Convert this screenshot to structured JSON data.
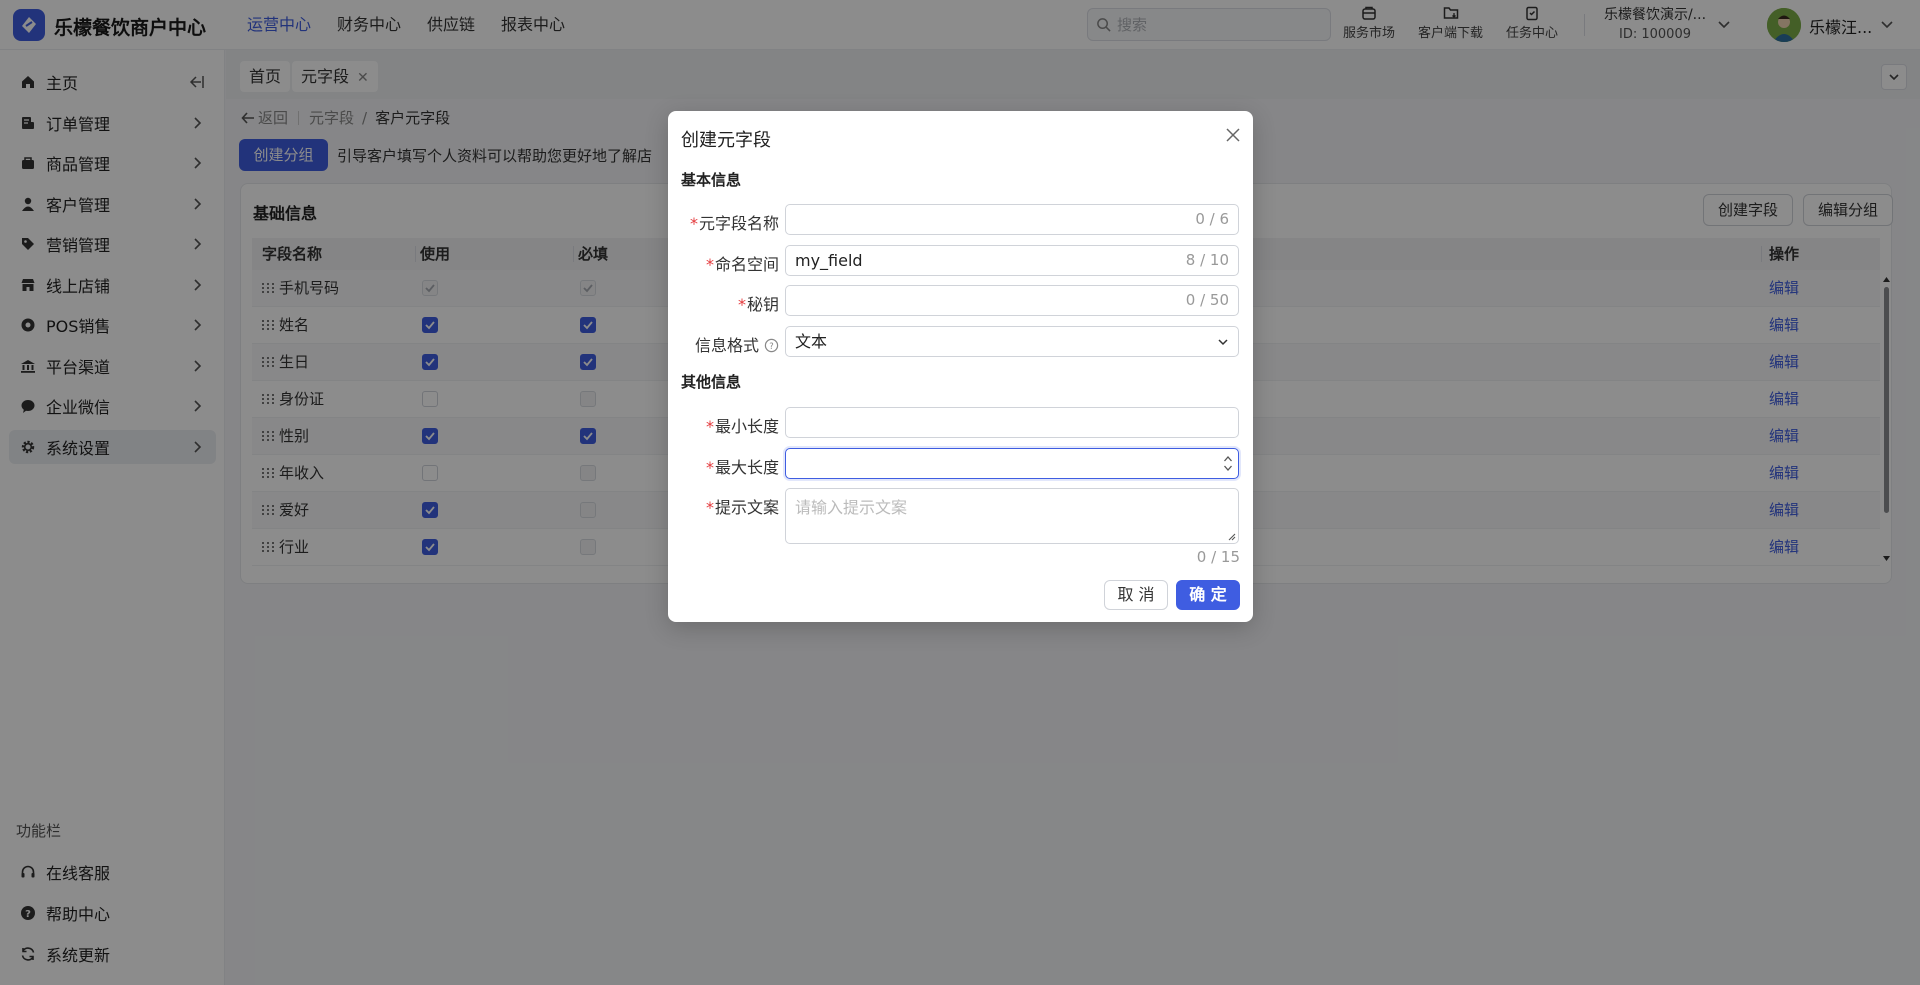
{
  "header": {
    "brand": "乐檬餐饮商户中心",
    "nav": [
      "运营中心",
      "财务中心",
      "供应链",
      "报表中心"
    ],
    "search_placeholder": "搜索",
    "icons": [
      {
        "label": "服务市场",
        "icon": "store-icon"
      },
      {
        "label": "客户端下载",
        "icon": "download-folder-icon"
      },
      {
        "label": "任务中心",
        "icon": "clipboard-icon"
      }
    ],
    "store_name": "乐檬餐饮演示/...",
    "store_id": "ID: 100009",
    "user_name": "乐檬汪..."
  },
  "sidebar": {
    "items": [
      {
        "label": "主页",
        "icon": "home-icon"
      },
      {
        "label": "订单管理",
        "icon": "order-icon"
      },
      {
        "label": "商品管理",
        "icon": "goods-icon"
      },
      {
        "label": "客户管理",
        "icon": "user-icon"
      },
      {
        "label": "营销管理",
        "icon": "tag-icon"
      },
      {
        "label": "线上店铺",
        "icon": "shop-icon"
      },
      {
        "label": "POS销售",
        "icon": "pos-icon"
      },
      {
        "label": "平台渠道",
        "icon": "bank-icon"
      },
      {
        "label": "企业微信",
        "icon": "chat-icon"
      },
      {
        "label": "系统设置",
        "icon": "gear-icon"
      }
    ],
    "func_title": "功能栏",
    "func_items": [
      {
        "label": "在线客服",
        "icon": "headset-icon"
      },
      {
        "label": "帮助中心",
        "icon": "help-icon"
      },
      {
        "label": "系统更新",
        "icon": "refresh-icon"
      }
    ]
  },
  "tabs": [
    {
      "label": "首页"
    },
    {
      "label": "元字段"
    }
  ],
  "breadcrumb": {
    "back": "返回",
    "parent": "元字段",
    "separator": "/",
    "current": "客户元字段"
  },
  "toolbar": {
    "create_group": "创建分组",
    "tip": "引导客户填写个人资料可以帮助您更好地了解店"
  },
  "card": {
    "title": "基础信息",
    "create_field": "创建字段",
    "edit_group": "编辑分组",
    "columns": [
      "字段名称",
      "使用",
      "必填",
      "操作"
    ],
    "rows": [
      {
        "name": "手机号码",
        "use": "disabled-checked",
        "required": "disabled-checked",
        "action": "编辑"
      },
      {
        "name": "姓名",
        "use": "checked",
        "required": "checked",
        "action": "编辑"
      },
      {
        "name": "生日",
        "use": "checked",
        "required": "checked",
        "action": "编辑"
      },
      {
        "name": "身份证",
        "use": "unchecked",
        "required": "disabled",
        "action": "编辑"
      },
      {
        "name": "性别",
        "use": "checked",
        "required": "checked",
        "action": "编辑"
      },
      {
        "name": "年收入",
        "use": "unchecked",
        "required": "disabled",
        "action": "编辑"
      },
      {
        "name": "爱好",
        "use": "checked",
        "required": "disabled",
        "action": "编辑"
      },
      {
        "name": "行业",
        "use": "checked",
        "required": "disabled",
        "action": "编辑"
      }
    ]
  },
  "modal": {
    "title": "创建元字段",
    "section_basic": "基本信息",
    "section_other": "其他信息",
    "fields": {
      "name": {
        "label": "元字段名称",
        "value": "",
        "count": "0 / 6"
      },
      "namespace": {
        "label": "命名空间",
        "value": "my_field",
        "count": "8 / 10"
      },
      "secret": {
        "label": "秘钥",
        "value": "",
        "count": "0 / 50"
      },
      "format": {
        "label": "信息格式",
        "value": "文本"
      },
      "min_len": {
        "label": "最小长度",
        "value": ""
      },
      "max_len": {
        "label": "最大长度",
        "value": ""
      },
      "hint": {
        "label": "提示文案",
        "placeholder": "请输入提示文案",
        "count": "0 / 15"
      }
    },
    "cancel": "取 消",
    "ok": "确 定"
  },
  "colors": {
    "primary": "#3f5de1",
    "required": "#e4393c"
  }
}
